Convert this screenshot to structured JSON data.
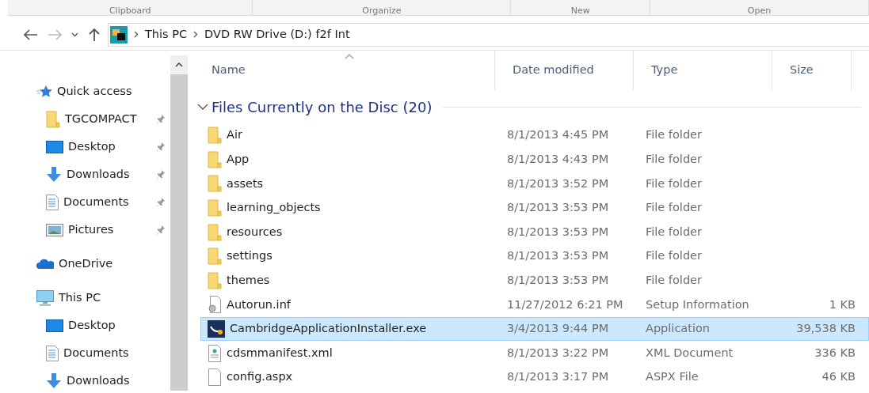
{
  "ribbon_groups": [
    "Clipboard",
    "Organize",
    "New",
    "Open"
  ],
  "address": {
    "crumbs": [
      "This PC",
      "DVD RW Drive (D:) f2f Int"
    ]
  },
  "nav": [
    {
      "label": "Quick access",
      "kind": "star",
      "children": [
        {
          "label": "TGCOMPACT",
          "kind": "folder",
          "pinned": true
        },
        {
          "label": "Desktop",
          "kind": "desktop",
          "pinned": true
        },
        {
          "label": "Downloads",
          "kind": "download",
          "pinned": true
        },
        {
          "label": "Documents",
          "kind": "document",
          "pinned": true
        },
        {
          "label": "Pictures",
          "kind": "picture",
          "pinned": true
        }
      ]
    },
    {
      "label": "OneDrive",
      "kind": "cloud"
    },
    {
      "label": "This PC",
      "kind": "pc",
      "children": [
        {
          "label": "Desktop",
          "kind": "desktop",
          "pinned": false
        },
        {
          "label": "Documents",
          "kind": "document",
          "pinned": false
        },
        {
          "label": "Downloads",
          "kind": "download",
          "pinned": false
        }
      ]
    }
  ],
  "columns": [
    "Name",
    "Date modified",
    "Type",
    "Size"
  ],
  "group": {
    "title": "Files Currently on the Disc (20)",
    "expanded": true
  },
  "rows": [
    {
      "kind": "folder",
      "name": "Air",
      "date": "8/1/2013 4:45 PM",
      "type": "File folder",
      "size": "",
      "selected": false
    },
    {
      "kind": "folder",
      "name": "App",
      "date": "8/1/2013 4:43 PM",
      "type": "File folder",
      "size": "",
      "selected": false
    },
    {
      "kind": "folder",
      "name": "assets",
      "date": "8/1/2013 3:52 PM",
      "type": "File folder",
      "size": "",
      "selected": false
    },
    {
      "kind": "folder",
      "name": "learning_objects",
      "date": "8/1/2013 3:53 PM",
      "type": "File folder",
      "size": "",
      "selected": false
    },
    {
      "kind": "folder",
      "name": "resources",
      "date": "8/1/2013 3:53 PM",
      "type": "File folder",
      "size": "",
      "selected": false
    },
    {
      "kind": "folder",
      "name": "settings",
      "date": "8/1/2013 3:53 PM",
      "type": "File folder",
      "size": "",
      "selected": false
    },
    {
      "kind": "folder",
      "name": "themes",
      "date": "8/1/2013 3:53 PM",
      "type": "File folder",
      "size": "",
      "selected": false
    },
    {
      "kind": "inf",
      "name": "Autorun.inf",
      "date": "11/27/2012 6:21 PM",
      "type": "Setup Information",
      "size": "1 KB",
      "selected": false
    },
    {
      "kind": "exe",
      "name": "CambridgeApplicationInstaller.exe",
      "date": "3/4/2013 9:44 PM",
      "type": "Application",
      "size": "39,538 KB",
      "selected": true
    },
    {
      "kind": "xml",
      "name": "cdsmmanifest.xml",
      "date": "8/1/2013 3:22 PM",
      "type": "XML Document",
      "size": "336 KB",
      "selected": false
    },
    {
      "kind": "file",
      "name": "config.aspx",
      "date": "8/1/2013 3:17 PM",
      "type": "ASPX File",
      "size": "46 KB",
      "selected": false
    }
  ]
}
